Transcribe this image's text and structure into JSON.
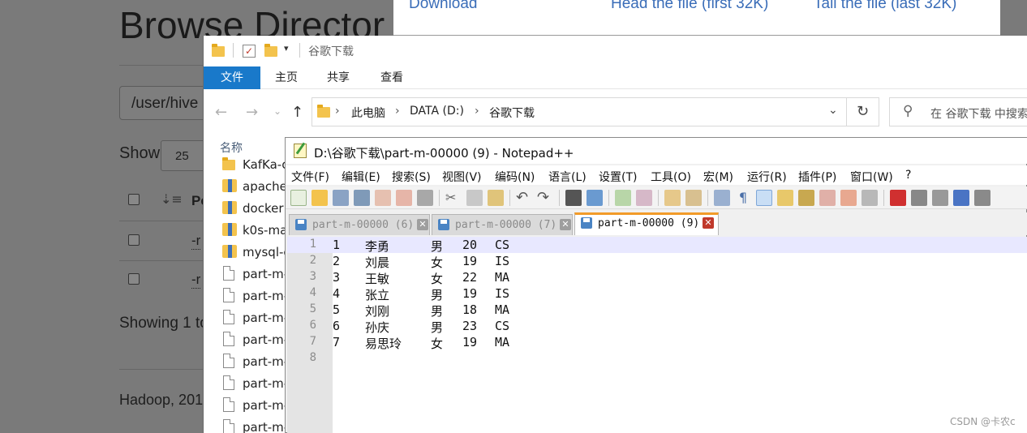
{
  "hadoop": {
    "title": "Browse Director",
    "path_value": "/user/hive",
    "show_label": "Show",
    "show_value": "25",
    "table_header_p": "Pe",
    "perm_row_1": "-r",
    "perm_row_2": "-r",
    "showing_text": "Showing 1 to",
    "footer_text": "Hadoop, 201"
  },
  "modal": {
    "download": "Download",
    "head": "Head the file (first 32K)",
    "tail": "Tail the file (last 32K)"
  },
  "explorer": {
    "window_title": "谷歌下载",
    "ribbon_tabs": [
      "文件",
      "主页",
      "共享",
      "查看"
    ],
    "breadcrumb": [
      "此电脑",
      "DATA (D:)",
      "谷歌下载"
    ],
    "search_placeholder": "在 谷歌下载 中搜索",
    "column_name": "名称",
    "files": [
      {
        "name": "KafKa-c",
        "icon": "folder-icon"
      },
      {
        "name": "apache",
        "icon": "zip-folder-icon"
      },
      {
        "name": "docker",
        "icon": "zip-folder-icon"
      },
      {
        "name": "k0s-ma",
        "icon": "zip-folder-icon"
      },
      {
        "name": "mysql-c",
        "icon": "zip-folder-icon"
      },
      {
        "name": "part-m-",
        "icon": "file-icon"
      },
      {
        "name": "part-m-",
        "icon": "file-icon"
      },
      {
        "name": "part-m-",
        "icon": "file-icon"
      },
      {
        "name": "part-m-",
        "icon": "file-icon"
      },
      {
        "name": "part-m-",
        "icon": "file-icon"
      },
      {
        "name": "part-m-",
        "icon": "file-icon"
      },
      {
        "name": "part-m-",
        "icon": "file-icon"
      },
      {
        "name": "part-m-",
        "icon": "file-icon"
      }
    ]
  },
  "notepad": {
    "title": "D:\\谷歌下载\\part-m-00000 (9) - Notepad++",
    "menu": [
      "文件(F)",
      "编辑(E)",
      "搜索(S)",
      "视图(V)",
      "编码(N)",
      "语言(L)",
      "设置(T)",
      "工具(O)",
      "宏(M)",
      "运行(R)",
      "插件(P)",
      "窗口(W)",
      "?"
    ],
    "tabs": [
      {
        "label": "part-m-00000 (6)",
        "active": false
      },
      {
        "label": "part-m-00000 (7)",
        "active": false
      },
      {
        "label": "part-m-00000 (9)",
        "active": true
      }
    ],
    "lines": [
      {
        "no": "1",
        "id": "1",
        "name": "李勇",
        "sex": "男",
        "age": "20",
        "dept": "CS"
      },
      {
        "no": "2",
        "id": "2",
        "name": "刘晨",
        "sex": "女",
        "age": "19",
        "dept": "IS"
      },
      {
        "no": "3",
        "id": "3",
        "name": "王敏",
        "sex": "女",
        "age": "22",
        "dept": "MA"
      },
      {
        "no": "4",
        "id": "4",
        "name": "张立",
        "sex": "男",
        "age": "19",
        "dept": "IS"
      },
      {
        "no": "5",
        "id": "5",
        "name": "刘刚",
        "sex": "男",
        "age": "18",
        "dept": "MA"
      },
      {
        "no": "6",
        "id": "6",
        "name": "孙庆",
        "sex": "男",
        "age": "23",
        "dept": "CS"
      },
      {
        "no": "7",
        "id": "7",
        "name": "易思玲",
        "sex": "女",
        "age": "19",
        "dept": "MA"
      },
      {
        "no": "8",
        "id": "",
        "name": "",
        "sex": "",
        "age": "",
        "dept": ""
      }
    ]
  },
  "watermark": "CSDN @卡农c",
  "colors": {
    "explorer_accent": "#1979ca",
    "npp_active_tab": "#f29b29",
    "link": "#3a6db8",
    "current_line": "#e8e8ff"
  }
}
